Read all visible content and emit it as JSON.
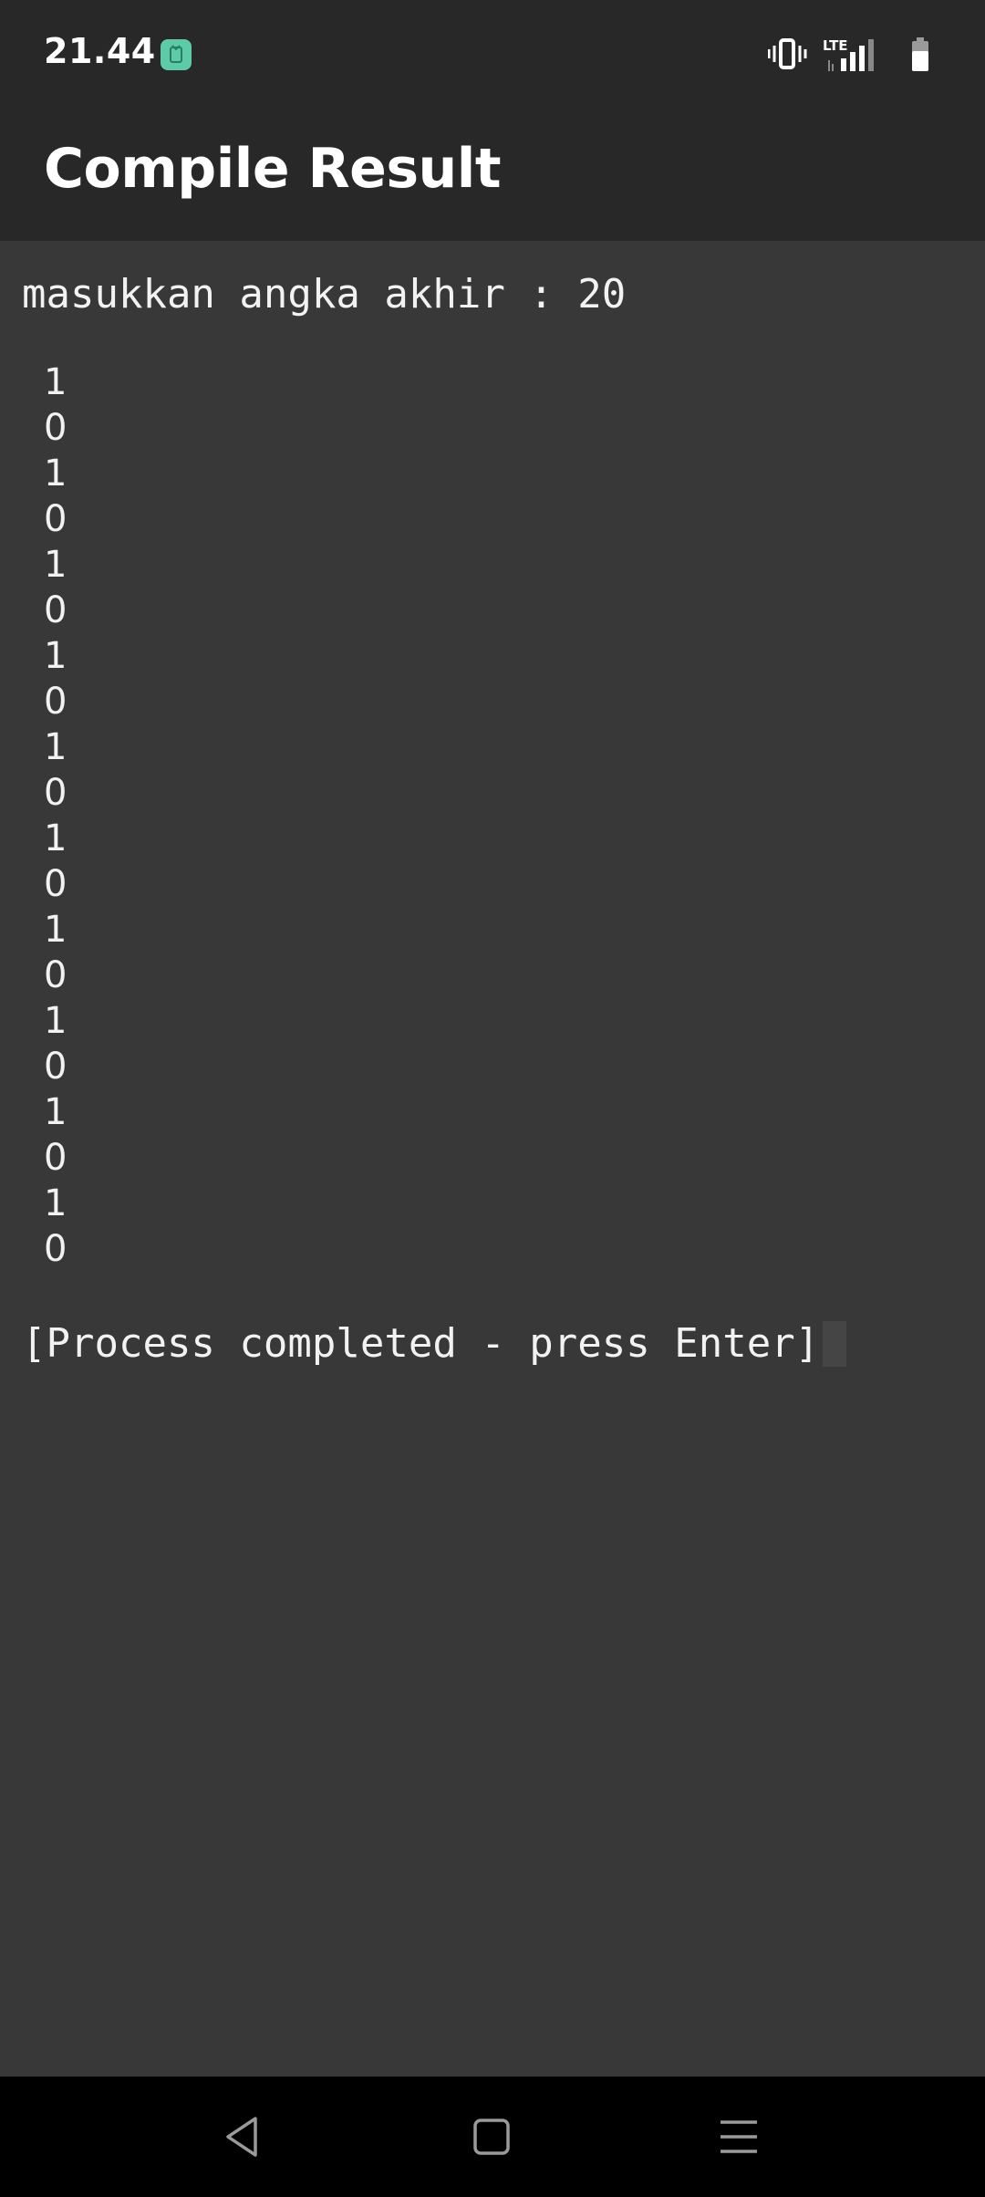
{
  "status_bar": {
    "time": "21.44",
    "network_label": "LTE",
    "icons": [
      "notification-app-icon",
      "vibrate-icon",
      "signal-icon",
      "battery-icon"
    ]
  },
  "app_bar": {
    "title": "Compile Result"
  },
  "terminal": {
    "prompt_line": "masukkan angka akhir : 20",
    "output": [
      "1",
      "0",
      "1",
      "0",
      "1",
      "0",
      "1",
      "0",
      "1",
      "0",
      "1",
      "0",
      "1",
      "0",
      "1",
      "0",
      "1",
      "0",
      "1",
      "0"
    ],
    "completion_line": "[Process completed - press Enter]"
  },
  "nav_bar": {
    "buttons": [
      "back-icon",
      "home-icon",
      "recents-menu-icon"
    ]
  },
  "colors": {
    "status_bar_bg": "#282828",
    "app_bar_bg": "#282828",
    "terminal_bg": "#383838",
    "text": "#f2f2f2",
    "nav_bar_bg": "#000000",
    "notification_accent": "#5ecba8"
  }
}
